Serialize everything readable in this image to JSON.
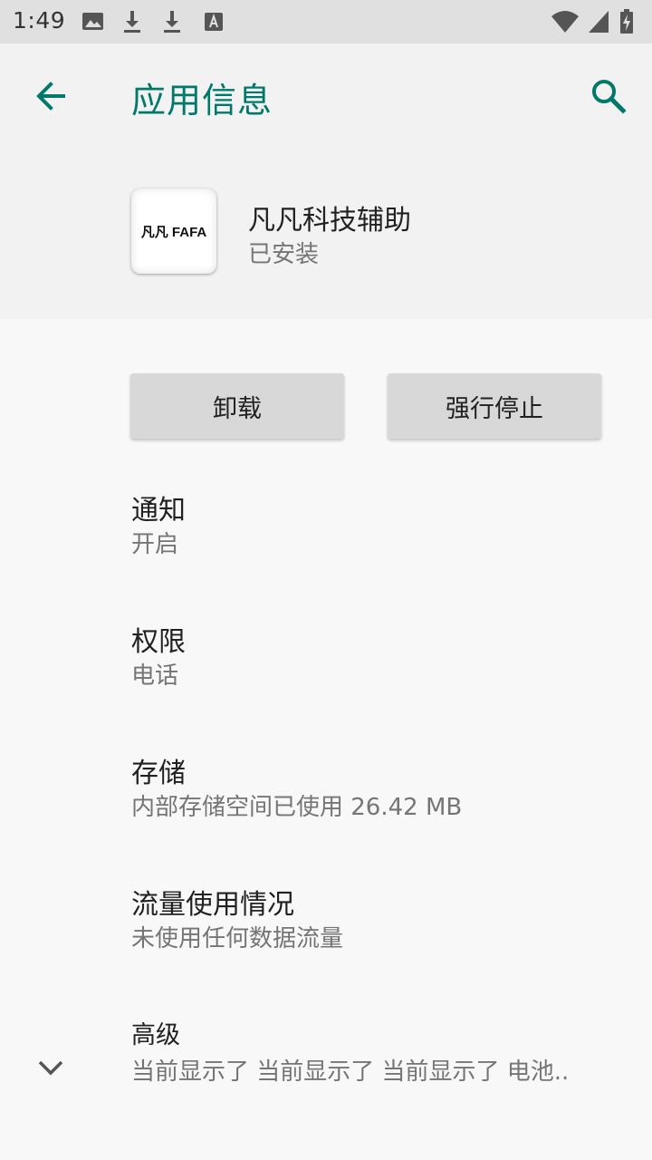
{
  "status_bar": {
    "time": "1:49",
    "left_icons": [
      "image-icon",
      "download-icon",
      "download-icon",
      "text-notification-icon"
    ],
    "right_icons": [
      "wifi-icon",
      "signal-icon",
      "battery-charging-icon"
    ]
  },
  "header": {
    "title": "应用信息",
    "back_icon": "arrow-left-icon",
    "search_icon": "search-icon"
  },
  "app": {
    "icon_text": "凡凡 FAFA",
    "name": "凡凡科技辅助",
    "status": "已安装"
  },
  "buttons": {
    "uninstall": "卸载",
    "force_stop": "强行停止"
  },
  "settings": [
    {
      "title": "通知",
      "summary": "开启"
    },
    {
      "title": "权限",
      "summary": "电话"
    },
    {
      "title": "存储",
      "summary": "内部存储空间已使用 26.42 MB"
    },
    {
      "title": "流量使用情况",
      "summary": "未使用任何数据流量"
    },
    {
      "title": "高级",
      "summary": "当前显示了 当前显示了 当前显示了 电池.."
    }
  ],
  "colors": {
    "accent": "#00796b",
    "status_bar": "#e0e0e0",
    "header_bg": "#f2f2f2",
    "button_bg": "#d8d8d8"
  }
}
